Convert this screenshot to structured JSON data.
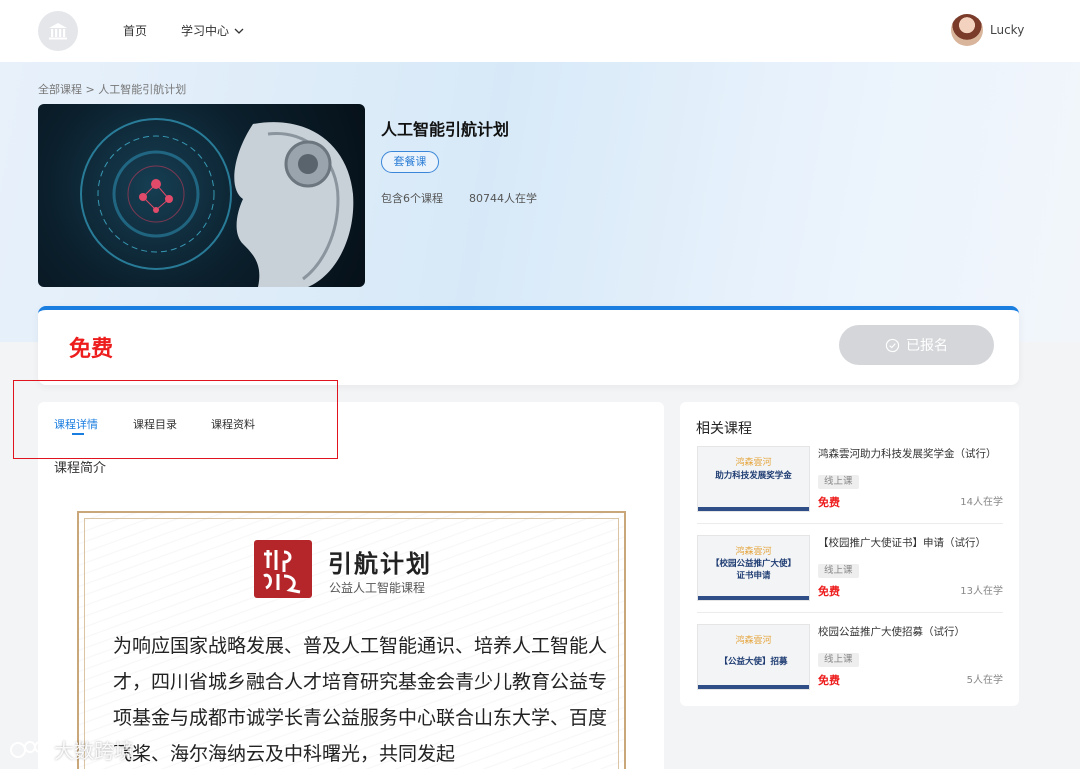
{
  "header": {
    "nav_home": "首页",
    "nav_learning": "学习中心",
    "username": "Lucky"
  },
  "breadcrumb": "全部课程 > 人工智能引航计划",
  "course": {
    "title": "人工智能引航计划",
    "tag": "套餐课",
    "course_count": "包含6个课程",
    "learners": "80744人在学"
  },
  "price_bar": {
    "price": "免费",
    "enroll_label": "已报名"
  },
  "tabs": [
    {
      "label": "课程详情",
      "active": true
    },
    {
      "label": "课程目录",
      "active": false
    },
    {
      "label": "课程资料",
      "active": false
    }
  ],
  "detail": {
    "section_title": "课程简介",
    "poster_title": "引航计划",
    "poster_subtitle": "公益人工智能课程",
    "poster_text": "为响应国家战略发展、普及人工智能通识、培养人工智能人才，四川省城乡融合人才培育研究基金会青少儿教育公益专项基金与成都市诚学长青公益服务中心联合山东大学、百度飞桨、海尔海纳云及中科曙光，共同发起"
  },
  "related": {
    "title": "相关课程",
    "items": [
      {
        "name": "鸿森雲河助力科技发展奖学金（试行）",
        "type": "线上课",
        "price": "免费",
        "learners": "14人在学",
        "thumb_top": "鸿森雲河",
        "thumb_main": "助力科技发展奖学金"
      },
      {
        "name": "【校园推广大使证书】申请（试行）",
        "type": "线上课",
        "price": "免费",
        "learners": "13人在学",
        "thumb_top": "鸿森雲河",
        "thumb_main": "【校园公益推广大使】证书申请"
      },
      {
        "name": "校园公益推广大使招募（试行）",
        "type": "线上课",
        "price": "免费",
        "learners": "5人在学",
        "thumb_top": "鸿森雲河",
        "thumb_main": "【公益大使】招募"
      }
    ]
  },
  "watermark": "大数跨境",
  "colors": {
    "accent": "#1a7de0",
    "price_red": "#ee1d1d",
    "annotation_box": "#e0141e"
  }
}
